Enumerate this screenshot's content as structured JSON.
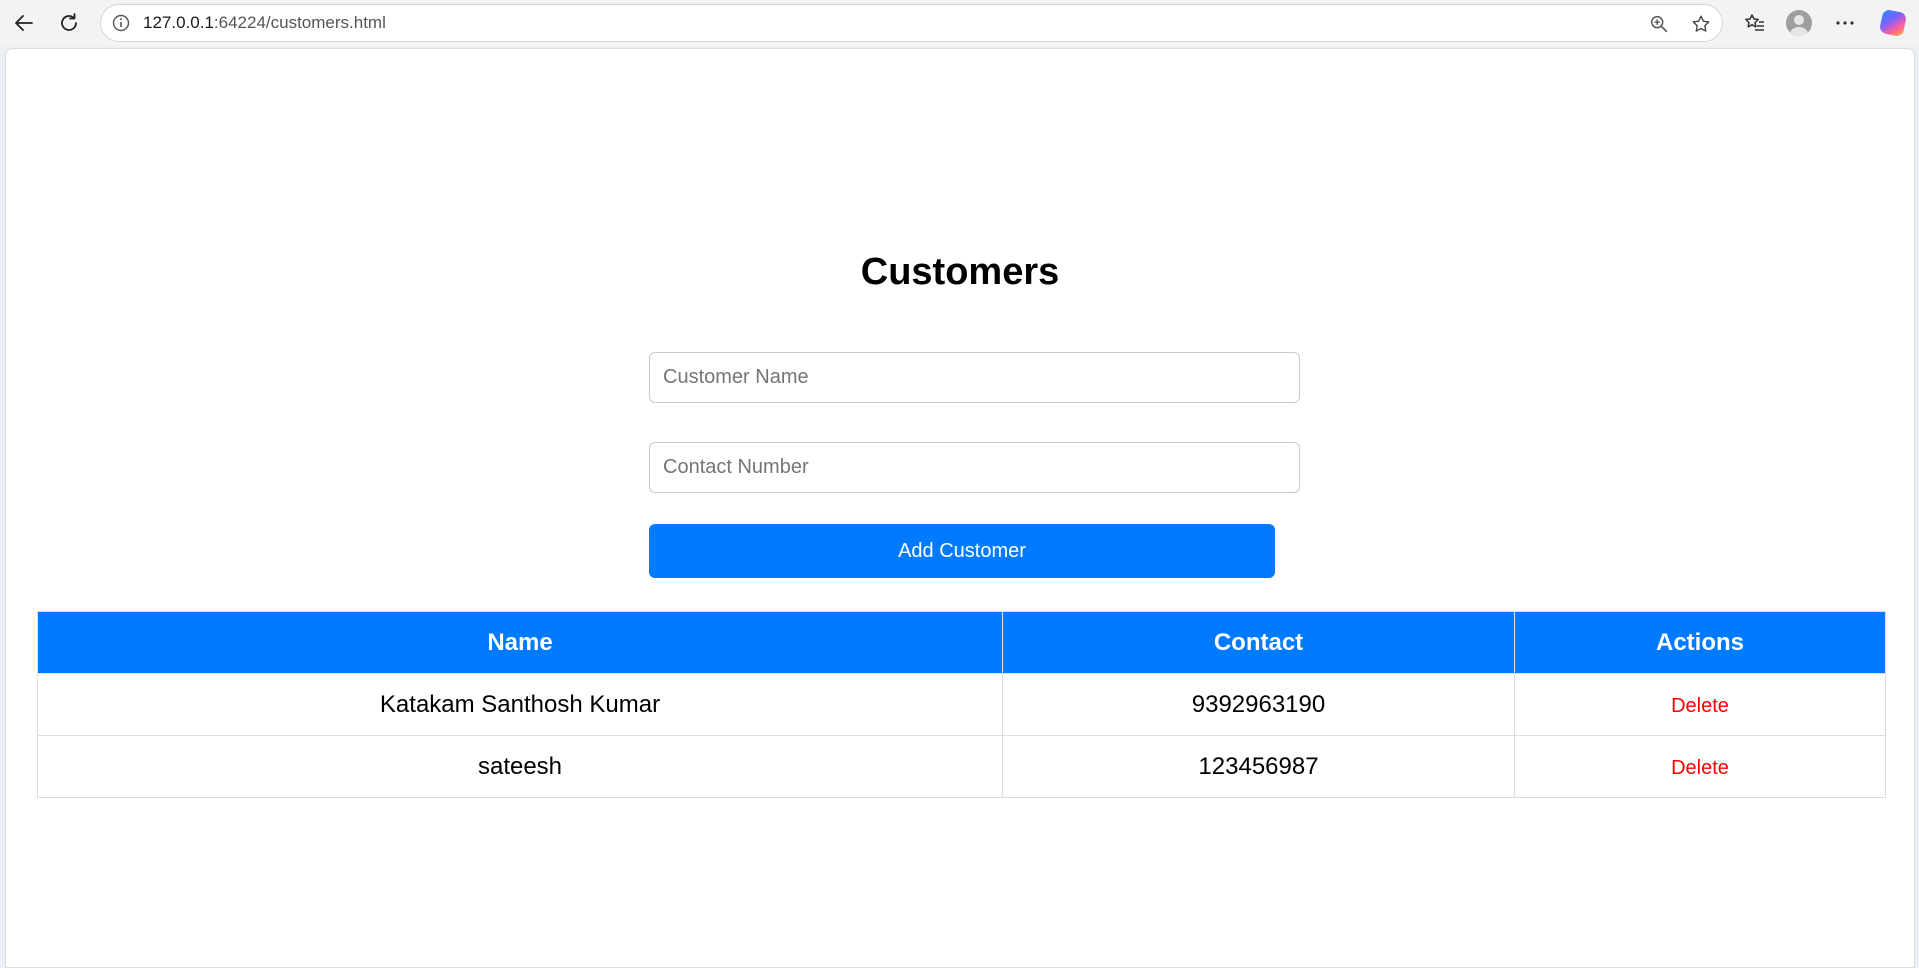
{
  "browser": {
    "url_host": "127.0.0.1",
    "url_rest": ":64224/customers.html",
    "icons": [
      "back-arrow-icon",
      "refresh-icon",
      "site-info-icon",
      "zoom-icon",
      "star-icon",
      "favorites-icon",
      "profile-icon",
      "more-icon",
      "copilot-icon"
    ]
  },
  "page": {
    "title": "Customers",
    "form": {
      "name_placeholder": "Customer Name",
      "name_value": "",
      "contact_placeholder": "Contact Number",
      "contact_value": "",
      "add_button_label": "Add Customer"
    },
    "table": {
      "headers": [
        "Name",
        "Contact",
        "Actions"
      ],
      "rows": [
        {
          "name": "Katakam Santhosh Kumar",
          "contact": "9392963190",
          "action": "Delete"
        },
        {
          "name": "sateesh",
          "contact": "123456987",
          "action": "Delete"
        }
      ]
    },
    "colors": {
      "primary": "#007bff",
      "delete": "#ff0000"
    }
  }
}
